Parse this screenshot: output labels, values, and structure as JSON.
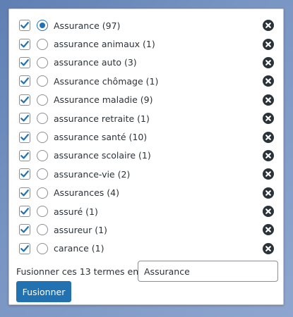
{
  "colors": {
    "accent": "#2271b1",
    "checkbox_check": "#2271b1",
    "remove_icon_bg": "#2c3338",
    "text": "#2c3338"
  },
  "icons": {
    "checkbox": "checkmark-icon",
    "radio": "radio-dot",
    "remove": "close-circle-icon"
  },
  "terms": [
    {
      "label": "Assurance (97)",
      "checked": true,
      "primary": true
    },
    {
      "label": "assurance animaux (1)",
      "checked": true,
      "primary": false
    },
    {
      "label": "assurance auto (3)",
      "checked": true,
      "primary": false
    },
    {
      "label": "Assurance chômage (1)",
      "checked": true,
      "primary": false
    },
    {
      "label": "Assurance maladie (9)",
      "checked": true,
      "primary": false
    },
    {
      "label": "assurance retraite (1)",
      "checked": true,
      "primary": false
    },
    {
      "label": "assurance santé (10)",
      "checked": true,
      "primary": false
    },
    {
      "label": "assurance scolaire (1)",
      "checked": true,
      "primary": false
    },
    {
      "label": "assurance-vie (2)",
      "checked": true,
      "primary": false
    },
    {
      "label": "Assurances (4)",
      "checked": true,
      "primary": false
    },
    {
      "label": "assuré (1)",
      "checked": true,
      "primary": false
    },
    {
      "label": "assureur (1)",
      "checked": true,
      "primary": false
    },
    {
      "label": "carance (1)",
      "checked": true,
      "primary": false
    }
  ],
  "merge": {
    "label": "Fusionner ces 13 termes en",
    "input_value": "Assurance",
    "button_label": "Fusionner"
  }
}
